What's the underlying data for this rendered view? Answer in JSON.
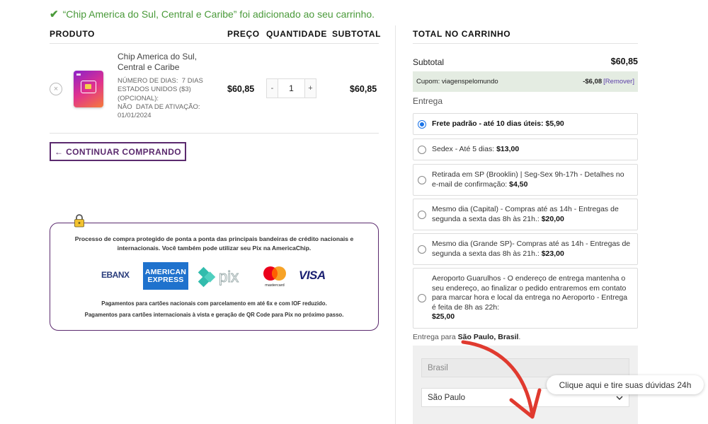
{
  "notice": {
    "icon": "check-icon",
    "text": "“Chip America do Sul, Central e Caribe” foi adicionado ao seu carrinho."
  },
  "cart_table": {
    "headers": {
      "product": "PRODUTO",
      "price": "PREÇO",
      "quantity": "QUANTIDADE",
      "subtotal": "SUBTOTAL"
    },
    "item": {
      "name": "Chip America do Sul, Central e Caribe",
      "meta": [
        {
          "label": "NÚMERO DE DIAS:",
          "value": "7 DIAS"
        },
        {
          "label": "ESTADOS UNIDOS ($3) (OPCIONAL):",
          "value": ""
        },
        {
          "label": "NÃO",
          "value": "DATA DE ATIVAÇÃO:"
        },
        {
          "label": "01/01/2024",
          "value": ""
        }
      ],
      "price": "$60,85",
      "quantity": "1",
      "qty_minus": "-",
      "qty_plus": "+",
      "subtotal": "$60,85",
      "remove_symbol": "×"
    }
  },
  "continue_button": "← CONTINUAR COMPRANDO",
  "secure_box": {
    "text": "Processo de compra protegido de ponta a ponta das principais bandeiras de crédito nacionais e internacionais. Você também pode utilizar seu Pix na AmericaChip.",
    "logos": {
      "ebanx": "EBANX",
      "amex_line1": "AMERICAN",
      "amex_line2": "EXPRESS",
      "pix": "pix",
      "mastercard": "mastercard",
      "visa": "VISA"
    },
    "note1": "Pagamentos para cartões nacionais com parcelamento em até 6x e com IOF reduzido.",
    "note2": "Pagamentos para cartões internacionais à vista e geração de QR Code para Pix no próximo passo."
  },
  "totals": {
    "title": "TOTAL NO CARRINHO",
    "subtotal_label": "Subtotal",
    "subtotal_value": "$60,85",
    "coupon_label": "Cupom: viagenspelomundo",
    "coupon_value": "-$6,08",
    "coupon_remove": "[Remover]",
    "shipping_label": "Entrega",
    "shipping_options": [
      {
        "text": "Frete padrão - até 10 dias úteis:",
        "price": "$5,90",
        "selected": true
      },
      {
        "text": "Sedex - Até 5 dias:",
        "price": "$13,00",
        "selected": false
      },
      {
        "text": "Retirada em SP (Brooklin) | Seg-Sex 9h-17h - Detalhes no e-mail de confirmação:",
        "price": "$4,50",
        "selected": false
      },
      {
        "text": "Mesmo dia (Capital) - Compras até as 14h - Entregas de segunda a sexta das 8h às 21h.:",
        "price": "$20,00",
        "selected": false
      },
      {
        "text": "Mesmo dia (Grande SP)- Compras até as 14h - Entregas de segunda a sexta das 8h às 21h.:",
        "price": "$23,00",
        "selected": false
      },
      {
        "text": "Aeroporto Guarulhos - O endereço de entrega mantenha o seu endereço, ao finalizar o pedido entraremos em contato para marcar hora e local da entrega no Aeroporto - Entrega é feita de 8h as 22h:",
        "price": "$25,00",
        "selected": false
      }
    ],
    "ship_to_prefix": "Entrega para",
    "ship_to_place": "São Paulo, Brasil",
    "country_field": "Brasil",
    "state_field": "São Paulo"
  },
  "help_bubble": "Clique aqui e tire suas dúvidas 24h",
  "colors": {
    "accent_purple": "#5b2a6e",
    "success_green": "#4a9a3a",
    "radio_blue": "#1a73e8",
    "arrow_red": "#e03a2f"
  }
}
